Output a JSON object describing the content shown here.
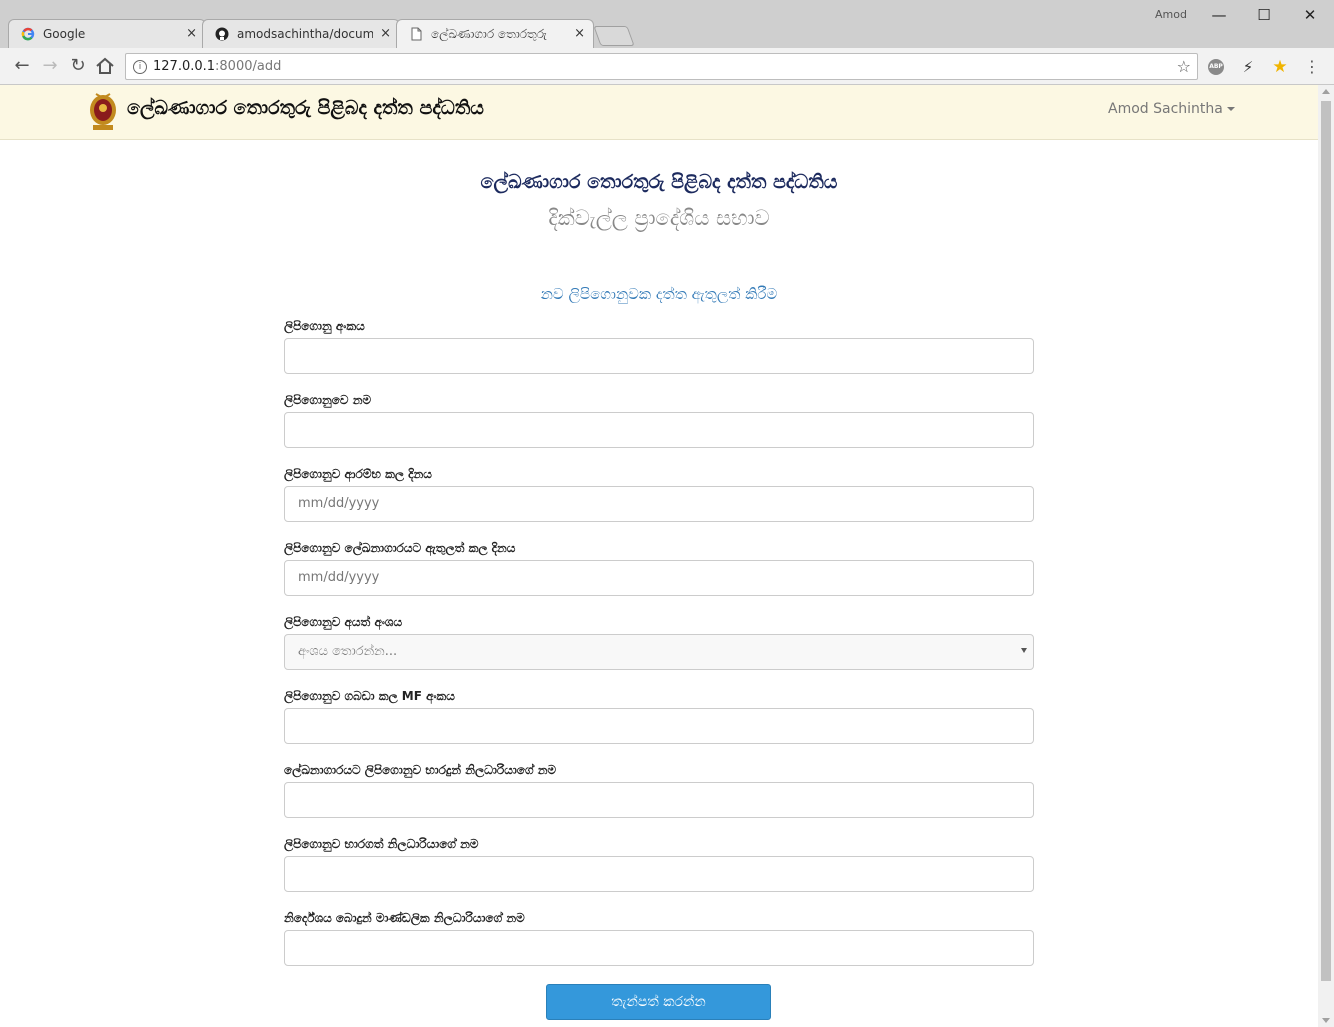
{
  "browser": {
    "tabs": [
      {
        "title": "Google",
        "icon": "google-icon",
        "close": "×"
      },
      {
        "title": "amodsachintha/documen",
        "icon": "github-icon",
        "close": "×"
      },
      {
        "title": "ලේඛණාගාර තොරතුරු",
        "icon": "page-icon",
        "close": "×"
      }
    ],
    "profile": "Amod",
    "window_controls": {
      "minimize": "—",
      "maximize": "☐",
      "close": "✕"
    },
    "url_host": "127.0.0.1",
    "url_path": ":8000/add",
    "abp_label": "ABP"
  },
  "navbar": {
    "brand": "ලේඛණාගාර තොරතුරු පිළිබද දත්ත පද්ධතිය",
    "user": "Amod Sachintha"
  },
  "page": {
    "title": "ලේඛණාගාර තොරතුරු පිළිබද දත්ත පද්ධතිය",
    "subtitle": "දික්වැල්ල ප්‍රාදේශිය සභාව",
    "form_title": "නව ලිපිගොනුවක දත්ත ඇතුලත් කිරීම"
  },
  "form": {
    "fields": [
      {
        "label": "ලිපිගොනු අංකය",
        "value": ""
      },
      {
        "label": "ලිපිගොනුවෙ නම",
        "value": ""
      },
      {
        "label": "ලිපිගොනුව ආරම්භ කල දිනය",
        "value": "mm/dd/yyyy"
      },
      {
        "label": "ලිපිගොනුව ලේඛනාගාරයට ඇතුලත් කල දිනය",
        "value": "mm/dd/yyyy"
      },
      {
        "label": "ලිපිගොනුව අයත් අංශය",
        "value": "අංශය තොරන්න..."
      },
      {
        "label": "ලිපිගොනුව ගබඩා කල MF අංකය",
        "value": ""
      },
      {
        "label": "ලේඛනාගාරයට ලිපිගොනුව භාරදුන් නිලධාරියාගේ නම",
        "value": ""
      },
      {
        "label": "ලිපිගොනුව භාරගත් නිලධාරියාගේ නම",
        "value": ""
      },
      {
        "label": "නිර්දේශය බොදුන් මාණ්ඩලික නිලධාරියාගේ නම",
        "value": ""
      }
    ],
    "submit": "තැන්පත් කරන්න"
  },
  "colors": {
    "navbar_bg": "#fcf8e3",
    "heading": "#1c2a5e",
    "form_title": "#337ab7",
    "submit_bg": "#3498db"
  }
}
